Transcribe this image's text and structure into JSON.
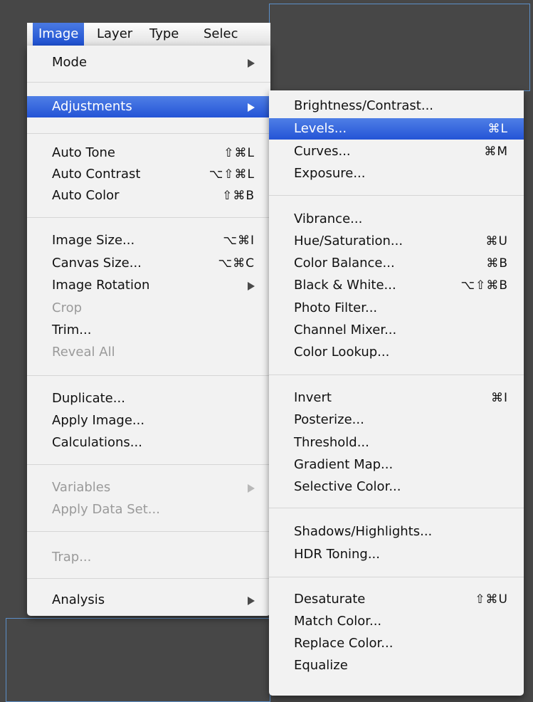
{
  "menubar": {
    "items": [
      {
        "label": "Image",
        "active": true
      },
      {
        "label": "Layer"
      },
      {
        "label": "Type"
      },
      {
        "label": "Selec"
      }
    ]
  },
  "image_menu": {
    "items": [
      {
        "label": "Mode",
        "submenu": true
      },
      {
        "label": "Adjustments",
        "submenu": true,
        "highlighted": true
      },
      {
        "label": "Auto Tone",
        "shortcut": "⇧⌘L"
      },
      {
        "label": "Auto Contrast",
        "shortcut": "⌥⇧⌘L"
      },
      {
        "label": "Auto Color",
        "shortcut": "⇧⌘B"
      },
      {
        "label": "Image Size...",
        "shortcut": "⌥⌘I"
      },
      {
        "label": "Canvas Size...",
        "shortcut": "⌥⌘C"
      },
      {
        "label": "Image Rotation",
        "submenu": true
      },
      {
        "label": "Crop",
        "disabled": true
      },
      {
        "label": "Trim..."
      },
      {
        "label": "Reveal All",
        "disabled": true
      },
      {
        "label": "Duplicate..."
      },
      {
        "label": "Apply Image..."
      },
      {
        "label": "Calculations..."
      },
      {
        "label": "Variables",
        "submenu": true,
        "disabled": true
      },
      {
        "label": "Apply Data Set...",
        "disabled": true
      },
      {
        "label": "Trap...",
        "disabled": true
      },
      {
        "label": "Analysis",
        "submenu": true
      }
    ]
  },
  "adjustments_menu": {
    "items": [
      {
        "label": "Brightness/Contrast..."
      },
      {
        "label": "Levels...",
        "shortcut": "⌘L",
        "highlighted": true
      },
      {
        "label": "Curves...",
        "shortcut": "⌘M"
      },
      {
        "label": "Exposure..."
      },
      {
        "label": "Vibrance..."
      },
      {
        "label": "Hue/Saturation...",
        "shortcut": "⌘U"
      },
      {
        "label": "Color Balance...",
        "shortcut": "⌘B"
      },
      {
        "label": "Black & White...",
        "shortcut": "⌥⇧⌘B"
      },
      {
        "label": "Photo Filter..."
      },
      {
        "label": "Channel Mixer..."
      },
      {
        "label": "Color Lookup..."
      },
      {
        "label": "Invert",
        "shortcut": "⌘I"
      },
      {
        "label": "Posterize..."
      },
      {
        "label": "Threshold..."
      },
      {
        "label": "Gradient Map..."
      },
      {
        "label": "Selective Color..."
      },
      {
        "label": "Shadows/Highlights..."
      },
      {
        "label": "HDR Toning..."
      },
      {
        "label": "Desaturate",
        "shortcut": "⇧⌘U"
      },
      {
        "label": "Match Color..."
      },
      {
        "label": "Replace Color..."
      },
      {
        "label": "Equalize"
      }
    ]
  },
  "colors": {
    "highlight": "#2454d6",
    "background": "#474747",
    "menu_bg": "#f2f2f2",
    "disabled_text": "#9a9a9a"
  }
}
